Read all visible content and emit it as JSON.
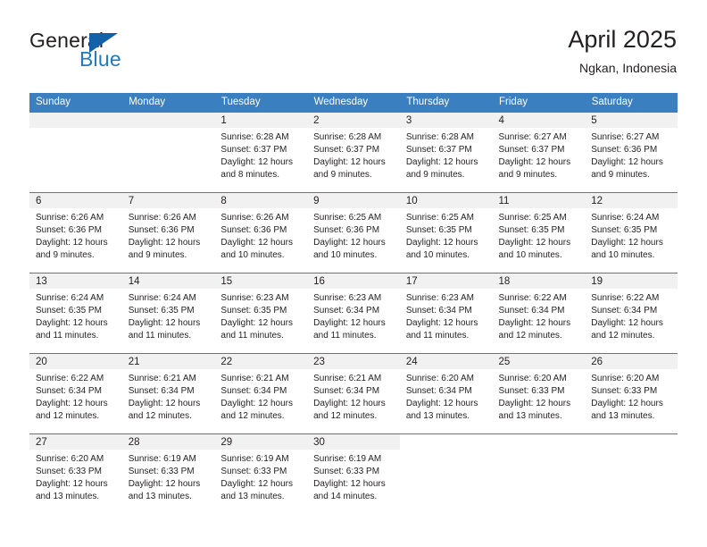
{
  "brand": {
    "name_primary": "General",
    "name_secondary": "Blue",
    "logo_icon": "triangle-play-icon"
  },
  "header": {
    "title": "April 2025",
    "subtitle": "Ngkan, Indonesia"
  },
  "colors": {
    "header_blue": "#3a7fc0",
    "brand_blue": "#1f7ac0",
    "logo_blue": "#1361a8",
    "daynum_band": "#f1f1f1",
    "text": "#231f20"
  },
  "calendar": {
    "weekday_headers": [
      "Sunday",
      "Monday",
      "Tuesday",
      "Wednesday",
      "Thursday",
      "Friday",
      "Saturday"
    ],
    "weeks": [
      [
        {
          "day": "",
          "lines": []
        },
        {
          "day": "",
          "lines": []
        },
        {
          "day": "1",
          "lines": [
            "Sunrise: 6:28 AM",
            "Sunset: 6:37 PM",
            "Daylight: 12 hours",
            "and 8 minutes."
          ]
        },
        {
          "day": "2",
          "lines": [
            "Sunrise: 6:28 AM",
            "Sunset: 6:37 PM",
            "Daylight: 12 hours",
            "and 9 minutes."
          ]
        },
        {
          "day": "3",
          "lines": [
            "Sunrise: 6:28 AM",
            "Sunset: 6:37 PM",
            "Daylight: 12 hours",
            "and 9 minutes."
          ]
        },
        {
          "day": "4",
          "lines": [
            "Sunrise: 6:27 AM",
            "Sunset: 6:37 PM",
            "Daylight: 12 hours",
            "and 9 minutes."
          ]
        },
        {
          "day": "5",
          "lines": [
            "Sunrise: 6:27 AM",
            "Sunset: 6:36 PM",
            "Daylight: 12 hours",
            "and 9 minutes."
          ]
        }
      ],
      [
        {
          "day": "6",
          "lines": [
            "Sunrise: 6:26 AM",
            "Sunset: 6:36 PM",
            "Daylight: 12 hours",
            "and 9 minutes."
          ]
        },
        {
          "day": "7",
          "lines": [
            "Sunrise: 6:26 AM",
            "Sunset: 6:36 PM",
            "Daylight: 12 hours",
            "and 9 minutes."
          ]
        },
        {
          "day": "8",
          "lines": [
            "Sunrise: 6:26 AM",
            "Sunset: 6:36 PM",
            "Daylight: 12 hours",
            "and 10 minutes."
          ]
        },
        {
          "day": "9",
          "lines": [
            "Sunrise: 6:25 AM",
            "Sunset: 6:36 PM",
            "Daylight: 12 hours",
            "and 10 minutes."
          ]
        },
        {
          "day": "10",
          "lines": [
            "Sunrise: 6:25 AM",
            "Sunset: 6:35 PM",
            "Daylight: 12 hours",
            "and 10 minutes."
          ]
        },
        {
          "day": "11",
          "lines": [
            "Sunrise: 6:25 AM",
            "Sunset: 6:35 PM",
            "Daylight: 12 hours",
            "and 10 minutes."
          ]
        },
        {
          "day": "12",
          "lines": [
            "Sunrise: 6:24 AM",
            "Sunset: 6:35 PM",
            "Daylight: 12 hours",
            "and 10 minutes."
          ]
        }
      ],
      [
        {
          "day": "13",
          "lines": [
            "Sunrise: 6:24 AM",
            "Sunset: 6:35 PM",
            "Daylight: 12 hours",
            "and 11 minutes."
          ]
        },
        {
          "day": "14",
          "lines": [
            "Sunrise: 6:24 AM",
            "Sunset: 6:35 PM",
            "Daylight: 12 hours",
            "and 11 minutes."
          ]
        },
        {
          "day": "15",
          "lines": [
            "Sunrise: 6:23 AM",
            "Sunset: 6:35 PM",
            "Daylight: 12 hours",
            "and 11 minutes."
          ]
        },
        {
          "day": "16",
          "lines": [
            "Sunrise: 6:23 AM",
            "Sunset: 6:34 PM",
            "Daylight: 12 hours",
            "and 11 minutes."
          ]
        },
        {
          "day": "17",
          "lines": [
            "Sunrise: 6:23 AM",
            "Sunset: 6:34 PM",
            "Daylight: 12 hours",
            "and 11 minutes."
          ]
        },
        {
          "day": "18",
          "lines": [
            "Sunrise: 6:22 AM",
            "Sunset: 6:34 PM",
            "Daylight: 12 hours",
            "and 12 minutes."
          ]
        },
        {
          "day": "19",
          "lines": [
            "Sunrise: 6:22 AM",
            "Sunset: 6:34 PM",
            "Daylight: 12 hours",
            "and 12 minutes."
          ]
        }
      ],
      [
        {
          "day": "20",
          "lines": [
            "Sunrise: 6:22 AM",
            "Sunset: 6:34 PM",
            "Daylight: 12 hours",
            "and 12 minutes."
          ]
        },
        {
          "day": "21",
          "lines": [
            "Sunrise: 6:21 AM",
            "Sunset: 6:34 PM",
            "Daylight: 12 hours",
            "and 12 minutes."
          ]
        },
        {
          "day": "22",
          "lines": [
            "Sunrise: 6:21 AM",
            "Sunset: 6:34 PM",
            "Daylight: 12 hours",
            "and 12 minutes."
          ]
        },
        {
          "day": "23",
          "lines": [
            "Sunrise: 6:21 AM",
            "Sunset: 6:34 PM",
            "Daylight: 12 hours",
            "and 12 minutes."
          ]
        },
        {
          "day": "24",
          "lines": [
            "Sunrise: 6:20 AM",
            "Sunset: 6:34 PM",
            "Daylight: 12 hours",
            "and 13 minutes."
          ]
        },
        {
          "day": "25",
          "lines": [
            "Sunrise: 6:20 AM",
            "Sunset: 6:33 PM",
            "Daylight: 12 hours",
            "and 13 minutes."
          ]
        },
        {
          "day": "26",
          "lines": [
            "Sunrise: 6:20 AM",
            "Sunset: 6:33 PM",
            "Daylight: 12 hours",
            "and 13 minutes."
          ]
        }
      ],
      [
        {
          "day": "27",
          "lines": [
            "Sunrise: 6:20 AM",
            "Sunset: 6:33 PM",
            "Daylight: 12 hours",
            "and 13 minutes."
          ]
        },
        {
          "day": "28",
          "lines": [
            "Sunrise: 6:19 AM",
            "Sunset: 6:33 PM",
            "Daylight: 12 hours",
            "and 13 minutes."
          ]
        },
        {
          "day": "29",
          "lines": [
            "Sunrise: 6:19 AM",
            "Sunset: 6:33 PM",
            "Daylight: 12 hours",
            "and 13 minutes."
          ]
        },
        {
          "day": "30",
          "lines": [
            "Sunrise: 6:19 AM",
            "Sunset: 6:33 PM",
            "Daylight: 12 hours",
            "and 14 minutes."
          ]
        },
        {
          "day": "",
          "lines": []
        },
        {
          "day": "",
          "lines": []
        },
        {
          "day": "",
          "lines": []
        }
      ]
    ]
  }
}
